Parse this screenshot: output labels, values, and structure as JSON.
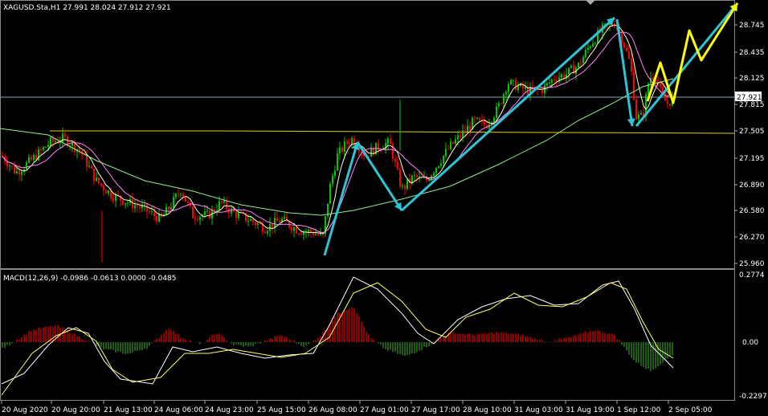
{
  "main_chart": {
    "header": "XAGUSD.Sta,H1  27.991 28.024 27.912 27.921",
    "current_price_tag": "27.921",
    "price_axis_labels": [
      "28.745",
      "28.435",
      "28.125",
      "27.815",
      "27.505",
      "27.195",
      "26.890",
      "26.580",
      "26.270",
      "25.960"
    ]
  },
  "macd_panel": {
    "header": "MACD(12,26,9) -0.0986 -0.0613 0.0000 -0.0485",
    "axis_labels": [
      "0.2774",
      "0.00",
      "-0.2297"
    ]
  },
  "time_axis_labels": [
    "20 Aug 2020",
    "20 Aug 20:00",
    "21 Aug 13:00",
    "24 Aug 06:00",
    "24 Aug 23:00",
    "25 Aug 15:00",
    "26 Aug 08:00",
    "27 Aug 01:00",
    "27 Aug 17:00",
    "28 Aug 10:00",
    "31 Aug 03:00",
    "31 Aug 19:00",
    "1 Sep 12:00",
    "2 Sep 05:00"
  ],
  "colors": {
    "background": "#000000",
    "bull_candle": "#00c800",
    "bear_candle": "#ff0000",
    "price_line": "#8fa3b8",
    "resistance_line": "#e0d000",
    "ma_fast": "#ffffcc",
    "ma_mid": "#ff80ff",
    "ma_slow": "#90ee90",
    "arrow_cyan": "#2ec4d6",
    "arrow_yellow": "#ffff00",
    "macd_hist_up": "#c00000",
    "macd_hist_down": "#2a7a1a",
    "macd_line": "#ffffff",
    "signal_line": "#ffff66"
  }
}
